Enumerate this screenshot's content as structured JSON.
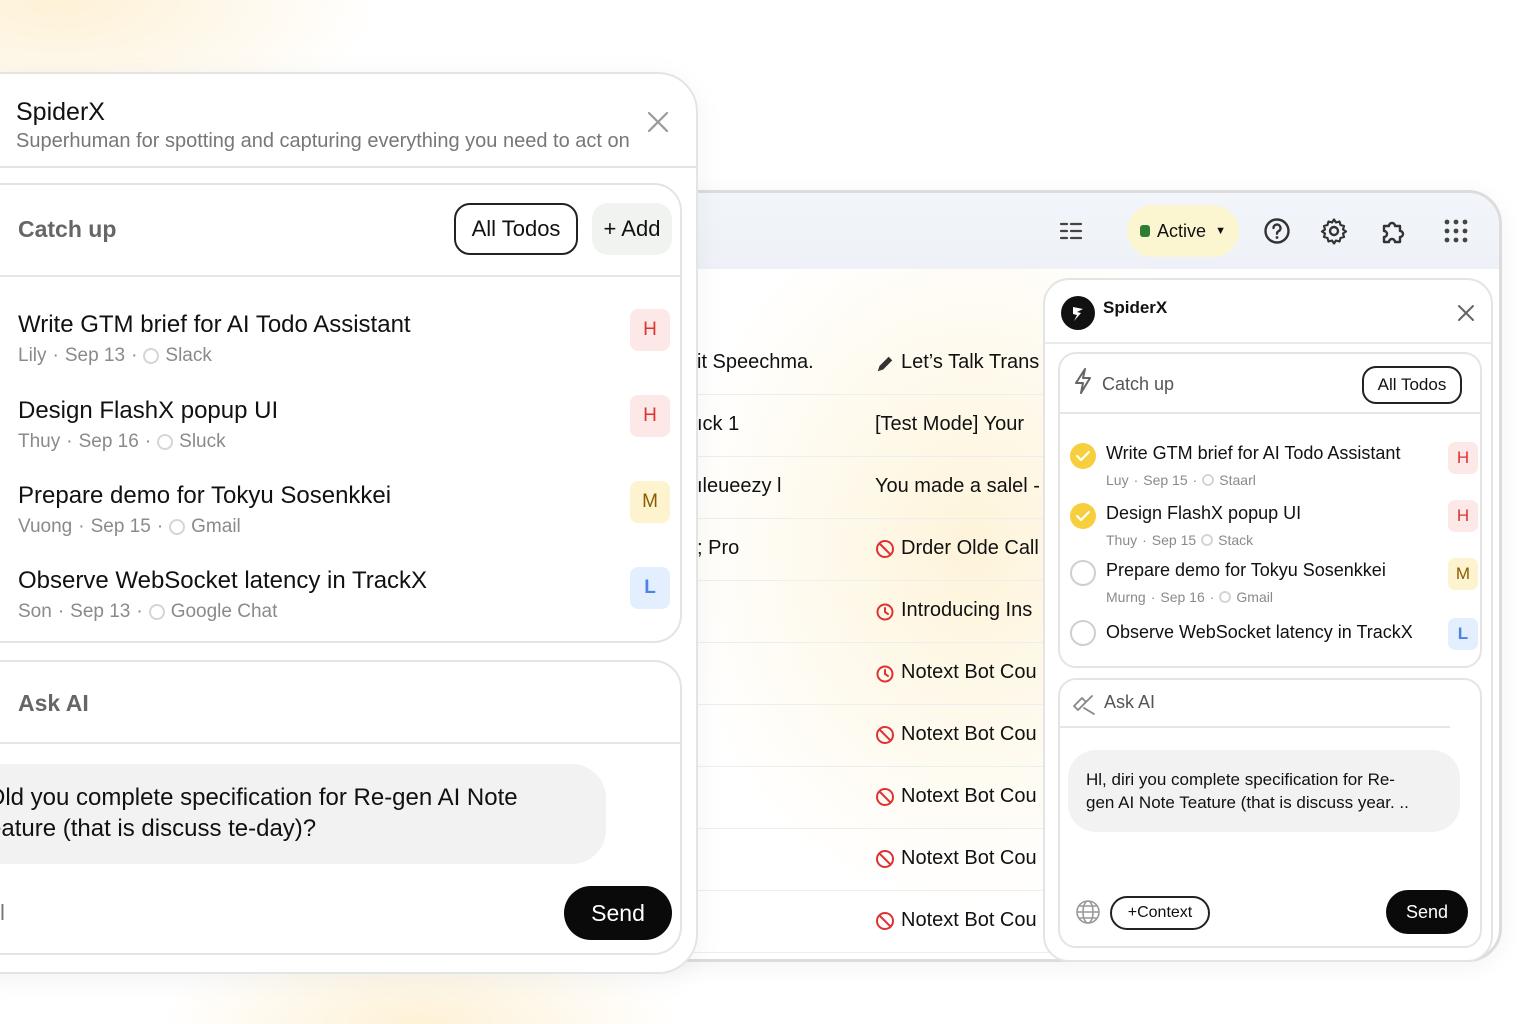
{
  "browser": {
    "status_label": "Active",
    "icons": [
      "list-icon",
      "lock-icon",
      "caret-down-icon",
      "help-icon",
      "settings-icon",
      "extension-icon",
      "apps-grid-icon"
    ],
    "rows": [
      {
        "sender": "it Speechma.",
        "subject": "Let’s Talk Trans",
        "icon": "pencil-icon"
      },
      {
        "sender": "ıck 1",
        "subject": "[Test Mode] Your",
        "icon": ""
      },
      {
        "sender": "ıleueezy l",
        "subject": "You made a salel -",
        "icon": ""
      },
      {
        "sender": "; Pro",
        "subject": "Drder Olde Call",
        "icon": "blocked-icon"
      },
      {
        "sender": "",
        "subject": "Introducing Ins",
        "icon": "snooze-icon"
      },
      {
        "sender": "",
        "subject": "Notext Bot Cou",
        "icon": "snooze-icon"
      },
      {
        "sender": "",
        "subject": "Notext Bot Cou",
        "icon": "blocked-icon"
      },
      {
        "sender": "",
        "subject": "Notext Bot Cou",
        "icon": "blocked-icon"
      },
      {
        "sender": "",
        "subject": "Notext Bot Cou",
        "icon": "blocked-icon"
      },
      {
        "sender": "",
        "subject": "Notext Bot Cou",
        "icon": "blocked-icon"
      }
    ]
  },
  "big_panel": {
    "title": "SpiderX",
    "subtitle": "Superhuman for spotting and capturing everything you need to act on",
    "catch_up": {
      "label": "Catch up",
      "all_todos_label": "All Todos",
      "add_label": "+ Add",
      "todos": [
        {
          "title": "Write GTM brief for AI Todo Assistant",
          "person": "Lily",
          "date": "Sep 13",
          "source": "Slack",
          "priority": "H"
        },
        {
          "title": "Design FlashX popup UI",
          "person": "Thuy",
          "date": "Sep 16",
          "source": "Sluck",
          "priority": "H"
        },
        {
          "title": "Prepare demo for Tokyu Sosenkkei",
          "person": "Vuong",
          "date": "Sep 15",
          "source": "Gmail",
          "priority": "M"
        },
        {
          "title": "Observe WebSocket latency in TrackX",
          "person": "Son",
          "date": "Sep 13",
          "source": "Google Chat",
          "priority": "L"
        }
      ]
    },
    "ask_ai": {
      "label": "Ask AI",
      "message_line1": "Dld you complete specification for Re-gen AI Note",
      "message_line2": "eature (that is discuss te-day)?",
      "input_value": "l",
      "send_label": "Send"
    }
  },
  "small_panel": {
    "title": "SpiderX",
    "catch_up": {
      "label": "Catch up",
      "all_todos_label": "All Todos",
      "todos": [
        {
          "title": "Write GTM brief for AI Todo Assistant",
          "person": "Luy",
          "date": "Sep 15",
          "source": "Staarl",
          "priority": "H",
          "done": true
        },
        {
          "title": "Design FlashX popup UI",
          "person": "Thuy",
          "date": "Sep 15",
          "source": "Stack",
          "priority": "H",
          "done": true
        },
        {
          "title": "Prepare demo for Tokyu Sosenkkei",
          "person": "Murng",
          "date": "Sep 16",
          "source": "Gmail",
          "priority": "M",
          "done": false
        },
        {
          "title": "Observe WebSocket latency in TrackX",
          "person": "",
          "date": "",
          "source": "",
          "priority": "L",
          "done": false
        }
      ]
    },
    "ask_ai": {
      "label": "Ask AI",
      "message_line1": "Hl, diri you complete specification for Re-",
      "message_line2": "gen AI Note Teature (that is discuss year. ..",
      "context_label": "+Context",
      "send_label": "Send"
    }
  },
  "colors": {
    "priority_high": "#d33333",
    "priority_medium": "#8a5a00",
    "priority_low": "#4a86e0",
    "accent_active": "#fbf6cf",
    "send_button": "#0a0a0a"
  }
}
